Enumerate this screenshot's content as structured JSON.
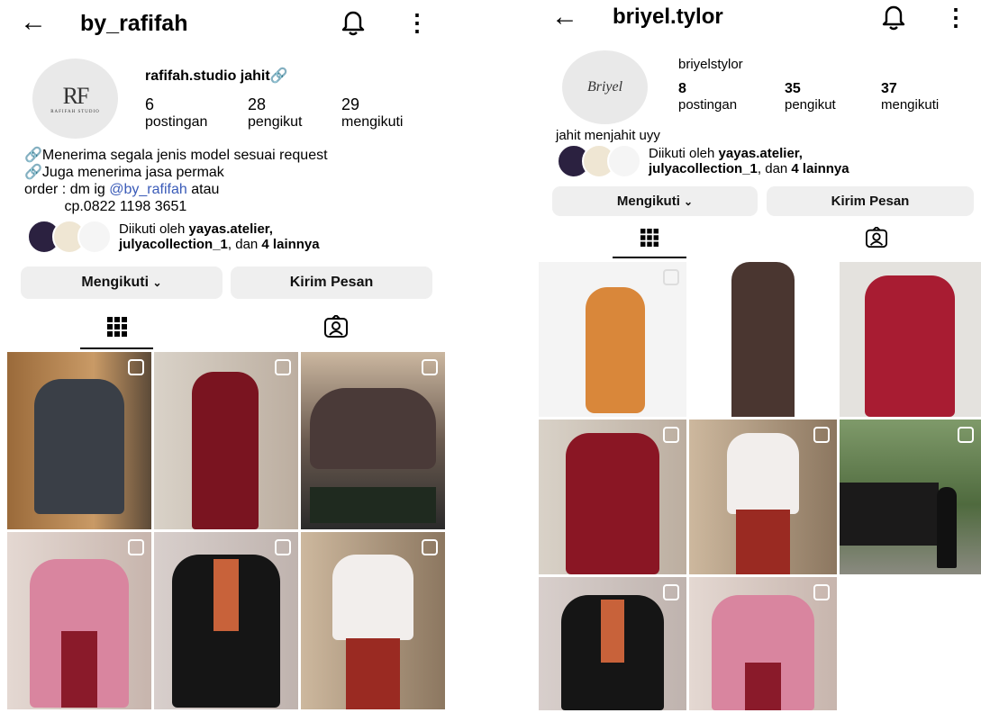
{
  "profiles": [
    {
      "username": "by_rafifah",
      "avatar_text": "RF",
      "avatar_caption": "RAFIFAH STUDIO",
      "name": "rafifah.studio jahit",
      "stats": [
        {
          "value": "6",
          "label": "postingan"
        },
        {
          "value": "28",
          "label": "pengikut"
        },
        {
          "value": "29",
          "label": "mengikuti"
        }
      ],
      "bio_lines": [
        "Menerima segala jenis model sesuai request",
        "Juga menerima jasa permak"
      ],
      "order_prefix": "order : dm ig ",
      "order_link": "@by_rafifah",
      "order_suffix": " atau",
      "phone_line": "cp.0822 1198 3651",
      "followed_pre": "Diikuti oleh ",
      "followed_b1": "yayas.atelier,",
      "followed_b2": "julyacollection_1",
      "followed_mid": ", dan ",
      "followed_b3": "4 lainnya",
      "follow_button": "Mengikuti",
      "message_button": "Kirim Pesan"
    },
    {
      "username": "briyel.tylor",
      "avatar_text": "Briyel",
      "name": "briyelstylor",
      "stats": [
        {
          "value": "8",
          "label": "postingan"
        },
        {
          "value": "35",
          "label": "pengikut"
        },
        {
          "value": "37",
          "label": "mengikuti"
        }
      ],
      "bio_lines": [
        "jahit menjahit uyy"
      ],
      "followed_pre": "Diikuti oleh ",
      "followed_b1": "yayas.atelier,",
      "followed_b2": "julyacollection_1",
      "followed_mid": ", dan ",
      "followed_b3": "4 lainnya",
      "follow_button": "Mengikuti",
      "message_button": "Kirim Pesan"
    }
  ],
  "icons": {
    "back": "arrow-left",
    "bell": "bell",
    "more": "vertical-dots",
    "grid": "grid",
    "tagged": "person-tag",
    "chevron": "chevron-down",
    "link": "link"
  },
  "colors": {
    "link": "#3a5bb8",
    "button_bg": "#efefef"
  }
}
